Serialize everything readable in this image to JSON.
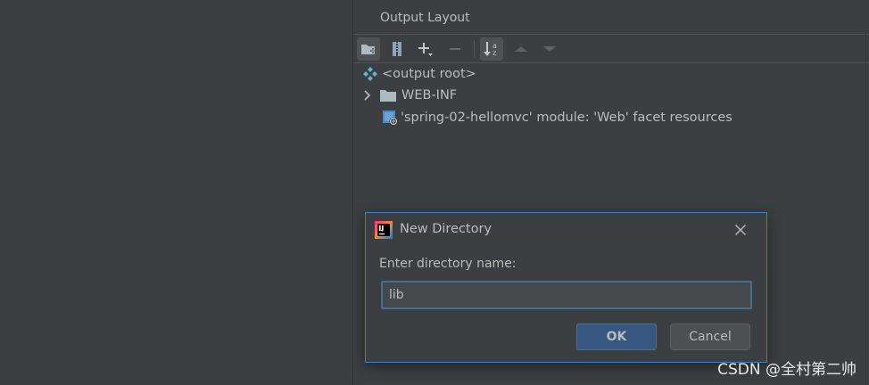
{
  "panel": {
    "title": "Output Layout"
  },
  "toolbar": {
    "icons": [
      "folder-add-icon",
      "archive-icon",
      "plus-dropdown-icon",
      "minus-icon",
      "sort-az-icon",
      "move-up-icon",
      "move-down-icon"
    ]
  },
  "tree": {
    "items": [
      {
        "label": "<output root>",
        "icon": "output-root-icon"
      },
      {
        "label": "WEB-INF",
        "icon": "folder-icon",
        "expandable": true
      },
      {
        "label": "'spring-02-hellomvc' module: 'Web' facet resources",
        "icon": "web-facet-icon"
      }
    ]
  },
  "dialog": {
    "title": "New Directory",
    "prompt": "Enter directory name:",
    "input_value": "lib",
    "ok_label": "OK",
    "cancel_label": "Cancel"
  },
  "watermark": "CSDN @全村第二帅",
  "colors": {
    "background": "#3c3f41",
    "text": "#bbbbbb",
    "dialog_border": "#3d7ec0",
    "ok_button": "#365880",
    "input_focus": "#466d94"
  }
}
